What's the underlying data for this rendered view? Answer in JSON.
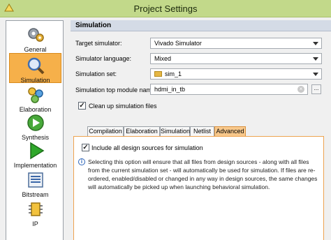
{
  "window": {
    "title": "Project Settings"
  },
  "sidebar": {
    "items": [
      {
        "label": "General"
      },
      {
        "label": "Simulation",
        "selected": true
      },
      {
        "label": "Elaboration"
      },
      {
        "label": "Synthesis"
      },
      {
        "label": "Implementation"
      },
      {
        "label": "Bitstream"
      },
      {
        "label": "IP"
      }
    ]
  },
  "main": {
    "section_title": "Simulation",
    "target_simulator": {
      "label": "Target simulator:",
      "value": "Vivado Simulator"
    },
    "simulator_language": {
      "label": "Simulator language:",
      "value": "Mixed"
    },
    "simulation_set": {
      "label": "Simulation set:",
      "value": "sim_1"
    },
    "top_module": {
      "label": "Simulation top module name:",
      "value": "hdmi_in_tb",
      "browse": "..."
    },
    "cleanup": {
      "label": "Clean up simulation files",
      "checked": true
    },
    "tabs": [
      "Compilation",
      "Elaboration",
      "Simulation",
      "Netlist",
      "Advanced"
    ],
    "active_tab": "Advanced",
    "advanced": {
      "include_all": {
        "label": "Include all design sources for simulation",
        "checked": true
      },
      "info": "Selecting this option will ensure that all files from design sources - along with all files from the current simulation set - will automatically be used for simulation. If files are re-ordered, enabled/disabled or changed in any way in design sources, the same changes will automatically be picked up when launching behavioral simulation."
    }
  },
  "colors": {
    "title_bar": "#c2d98a",
    "selected_item": "#f6b04a",
    "active_tab": "#f8c88b",
    "panel_border": "#eea350",
    "section_header": "#d4dbe6"
  }
}
